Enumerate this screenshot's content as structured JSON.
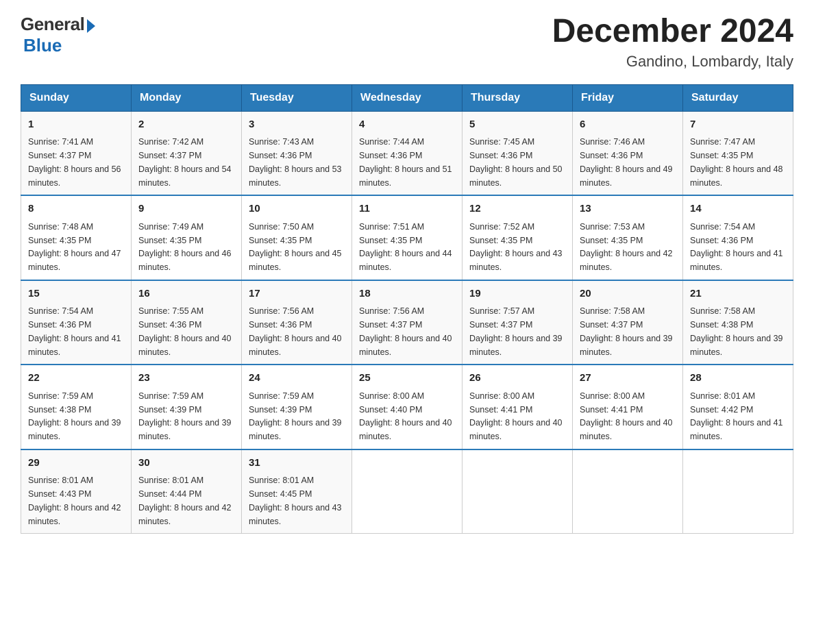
{
  "header": {
    "logo_general": "General",
    "logo_blue": "Blue",
    "month_year": "December 2024",
    "location": "Gandino, Lombardy, Italy"
  },
  "days_of_week": [
    "Sunday",
    "Monday",
    "Tuesday",
    "Wednesday",
    "Thursday",
    "Friday",
    "Saturday"
  ],
  "weeks": [
    [
      {
        "day": "1",
        "sunrise": "7:41 AM",
        "sunset": "4:37 PM",
        "daylight": "8 hours and 56 minutes."
      },
      {
        "day": "2",
        "sunrise": "7:42 AM",
        "sunset": "4:37 PM",
        "daylight": "8 hours and 54 minutes."
      },
      {
        "day": "3",
        "sunrise": "7:43 AM",
        "sunset": "4:36 PM",
        "daylight": "8 hours and 53 minutes."
      },
      {
        "day": "4",
        "sunrise": "7:44 AM",
        "sunset": "4:36 PM",
        "daylight": "8 hours and 51 minutes."
      },
      {
        "day": "5",
        "sunrise": "7:45 AM",
        "sunset": "4:36 PM",
        "daylight": "8 hours and 50 minutes."
      },
      {
        "day": "6",
        "sunrise": "7:46 AM",
        "sunset": "4:36 PM",
        "daylight": "8 hours and 49 minutes."
      },
      {
        "day": "7",
        "sunrise": "7:47 AM",
        "sunset": "4:35 PM",
        "daylight": "8 hours and 48 minutes."
      }
    ],
    [
      {
        "day": "8",
        "sunrise": "7:48 AM",
        "sunset": "4:35 PM",
        "daylight": "8 hours and 47 minutes."
      },
      {
        "day": "9",
        "sunrise": "7:49 AM",
        "sunset": "4:35 PM",
        "daylight": "8 hours and 46 minutes."
      },
      {
        "day": "10",
        "sunrise": "7:50 AM",
        "sunset": "4:35 PM",
        "daylight": "8 hours and 45 minutes."
      },
      {
        "day": "11",
        "sunrise": "7:51 AM",
        "sunset": "4:35 PM",
        "daylight": "8 hours and 44 minutes."
      },
      {
        "day": "12",
        "sunrise": "7:52 AM",
        "sunset": "4:35 PM",
        "daylight": "8 hours and 43 minutes."
      },
      {
        "day": "13",
        "sunrise": "7:53 AM",
        "sunset": "4:35 PM",
        "daylight": "8 hours and 42 minutes."
      },
      {
        "day": "14",
        "sunrise": "7:54 AM",
        "sunset": "4:36 PM",
        "daylight": "8 hours and 41 minutes."
      }
    ],
    [
      {
        "day": "15",
        "sunrise": "7:54 AM",
        "sunset": "4:36 PM",
        "daylight": "8 hours and 41 minutes."
      },
      {
        "day": "16",
        "sunrise": "7:55 AM",
        "sunset": "4:36 PM",
        "daylight": "8 hours and 40 minutes."
      },
      {
        "day": "17",
        "sunrise": "7:56 AM",
        "sunset": "4:36 PM",
        "daylight": "8 hours and 40 minutes."
      },
      {
        "day": "18",
        "sunrise": "7:56 AM",
        "sunset": "4:37 PM",
        "daylight": "8 hours and 40 minutes."
      },
      {
        "day": "19",
        "sunrise": "7:57 AM",
        "sunset": "4:37 PM",
        "daylight": "8 hours and 39 minutes."
      },
      {
        "day": "20",
        "sunrise": "7:58 AM",
        "sunset": "4:37 PM",
        "daylight": "8 hours and 39 minutes."
      },
      {
        "day": "21",
        "sunrise": "7:58 AM",
        "sunset": "4:38 PM",
        "daylight": "8 hours and 39 minutes."
      }
    ],
    [
      {
        "day": "22",
        "sunrise": "7:59 AM",
        "sunset": "4:38 PM",
        "daylight": "8 hours and 39 minutes."
      },
      {
        "day": "23",
        "sunrise": "7:59 AM",
        "sunset": "4:39 PM",
        "daylight": "8 hours and 39 minutes."
      },
      {
        "day": "24",
        "sunrise": "7:59 AM",
        "sunset": "4:39 PM",
        "daylight": "8 hours and 39 minutes."
      },
      {
        "day": "25",
        "sunrise": "8:00 AM",
        "sunset": "4:40 PM",
        "daylight": "8 hours and 40 minutes."
      },
      {
        "day": "26",
        "sunrise": "8:00 AM",
        "sunset": "4:41 PM",
        "daylight": "8 hours and 40 minutes."
      },
      {
        "day": "27",
        "sunrise": "8:00 AM",
        "sunset": "4:41 PM",
        "daylight": "8 hours and 40 minutes."
      },
      {
        "day": "28",
        "sunrise": "8:01 AM",
        "sunset": "4:42 PM",
        "daylight": "8 hours and 41 minutes."
      }
    ],
    [
      {
        "day": "29",
        "sunrise": "8:01 AM",
        "sunset": "4:43 PM",
        "daylight": "8 hours and 42 minutes."
      },
      {
        "day": "30",
        "sunrise": "8:01 AM",
        "sunset": "4:44 PM",
        "daylight": "8 hours and 42 minutes."
      },
      {
        "day": "31",
        "sunrise": "8:01 AM",
        "sunset": "4:45 PM",
        "daylight": "8 hours and 43 minutes."
      },
      null,
      null,
      null,
      null
    ]
  ],
  "labels": {
    "sunrise": "Sunrise:",
    "sunset": "Sunset:",
    "daylight": "Daylight:"
  }
}
